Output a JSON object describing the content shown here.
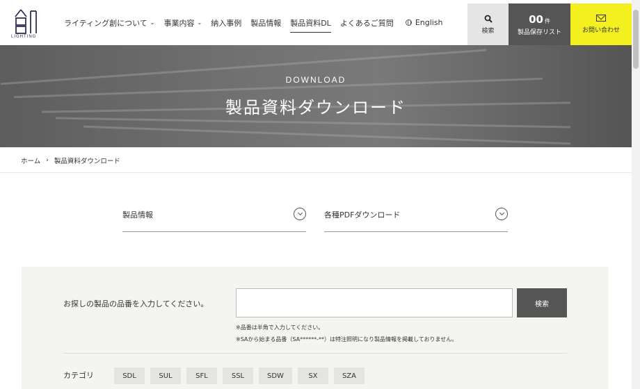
{
  "header": {
    "logo": {
      "text": "LIGHTING",
      "icon": "so-logo-icon"
    },
    "nav": [
      {
        "label": "ライティング創について",
        "has_dropdown": true
      },
      {
        "label": "事業内容",
        "has_dropdown": true
      },
      {
        "label": "納入事例",
        "has_dropdown": false
      },
      {
        "label": "製品情報",
        "has_dropdown": false
      },
      {
        "label": "製品資料DL",
        "has_dropdown": false,
        "active": true
      },
      {
        "label": "よくあるご質問",
        "has_dropdown": false
      }
    ],
    "english": "English",
    "search_label": "検索",
    "list": {
      "count": "00",
      "unit": "件",
      "label": "製品保存リスト"
    },
    "contact_label": "お問い合わせ",
    "accent_color": "#f4ef1e"
  },
  "hero": {
    "subtitle": "DOWNLOAD",
    "title": "製品資料ダウンロード"
  },
  "breadcrumb": {
    "home": "ホーム",
    "separator": "›",
    "current": "製品資料ダウンロード"
  },
  "dropdowns": [
    {
      "label": "製品情報"
    },
    {
      "label": "各種PDFダウンロード"
    }
  ],
  "search_panel": {
    "label": "お探しの製品の品番を入力してください。",
    "input_value": "",
    "input_placeholder": "",
    "button_label": "検索",
    "notes": [
      "※品番は半角で入力してください。",
      "※SAから始まる品番（SA******-**）は特注照明になり製品情報を掲載しておりません。"
    ],
    "category_label": "カテゴリ",
    "categories": [
      "SDL",
      "SUL",
      "SFL",
      "SSL",
      "SDW",
      "SX",
      "SZA"
    ]
  }
}
